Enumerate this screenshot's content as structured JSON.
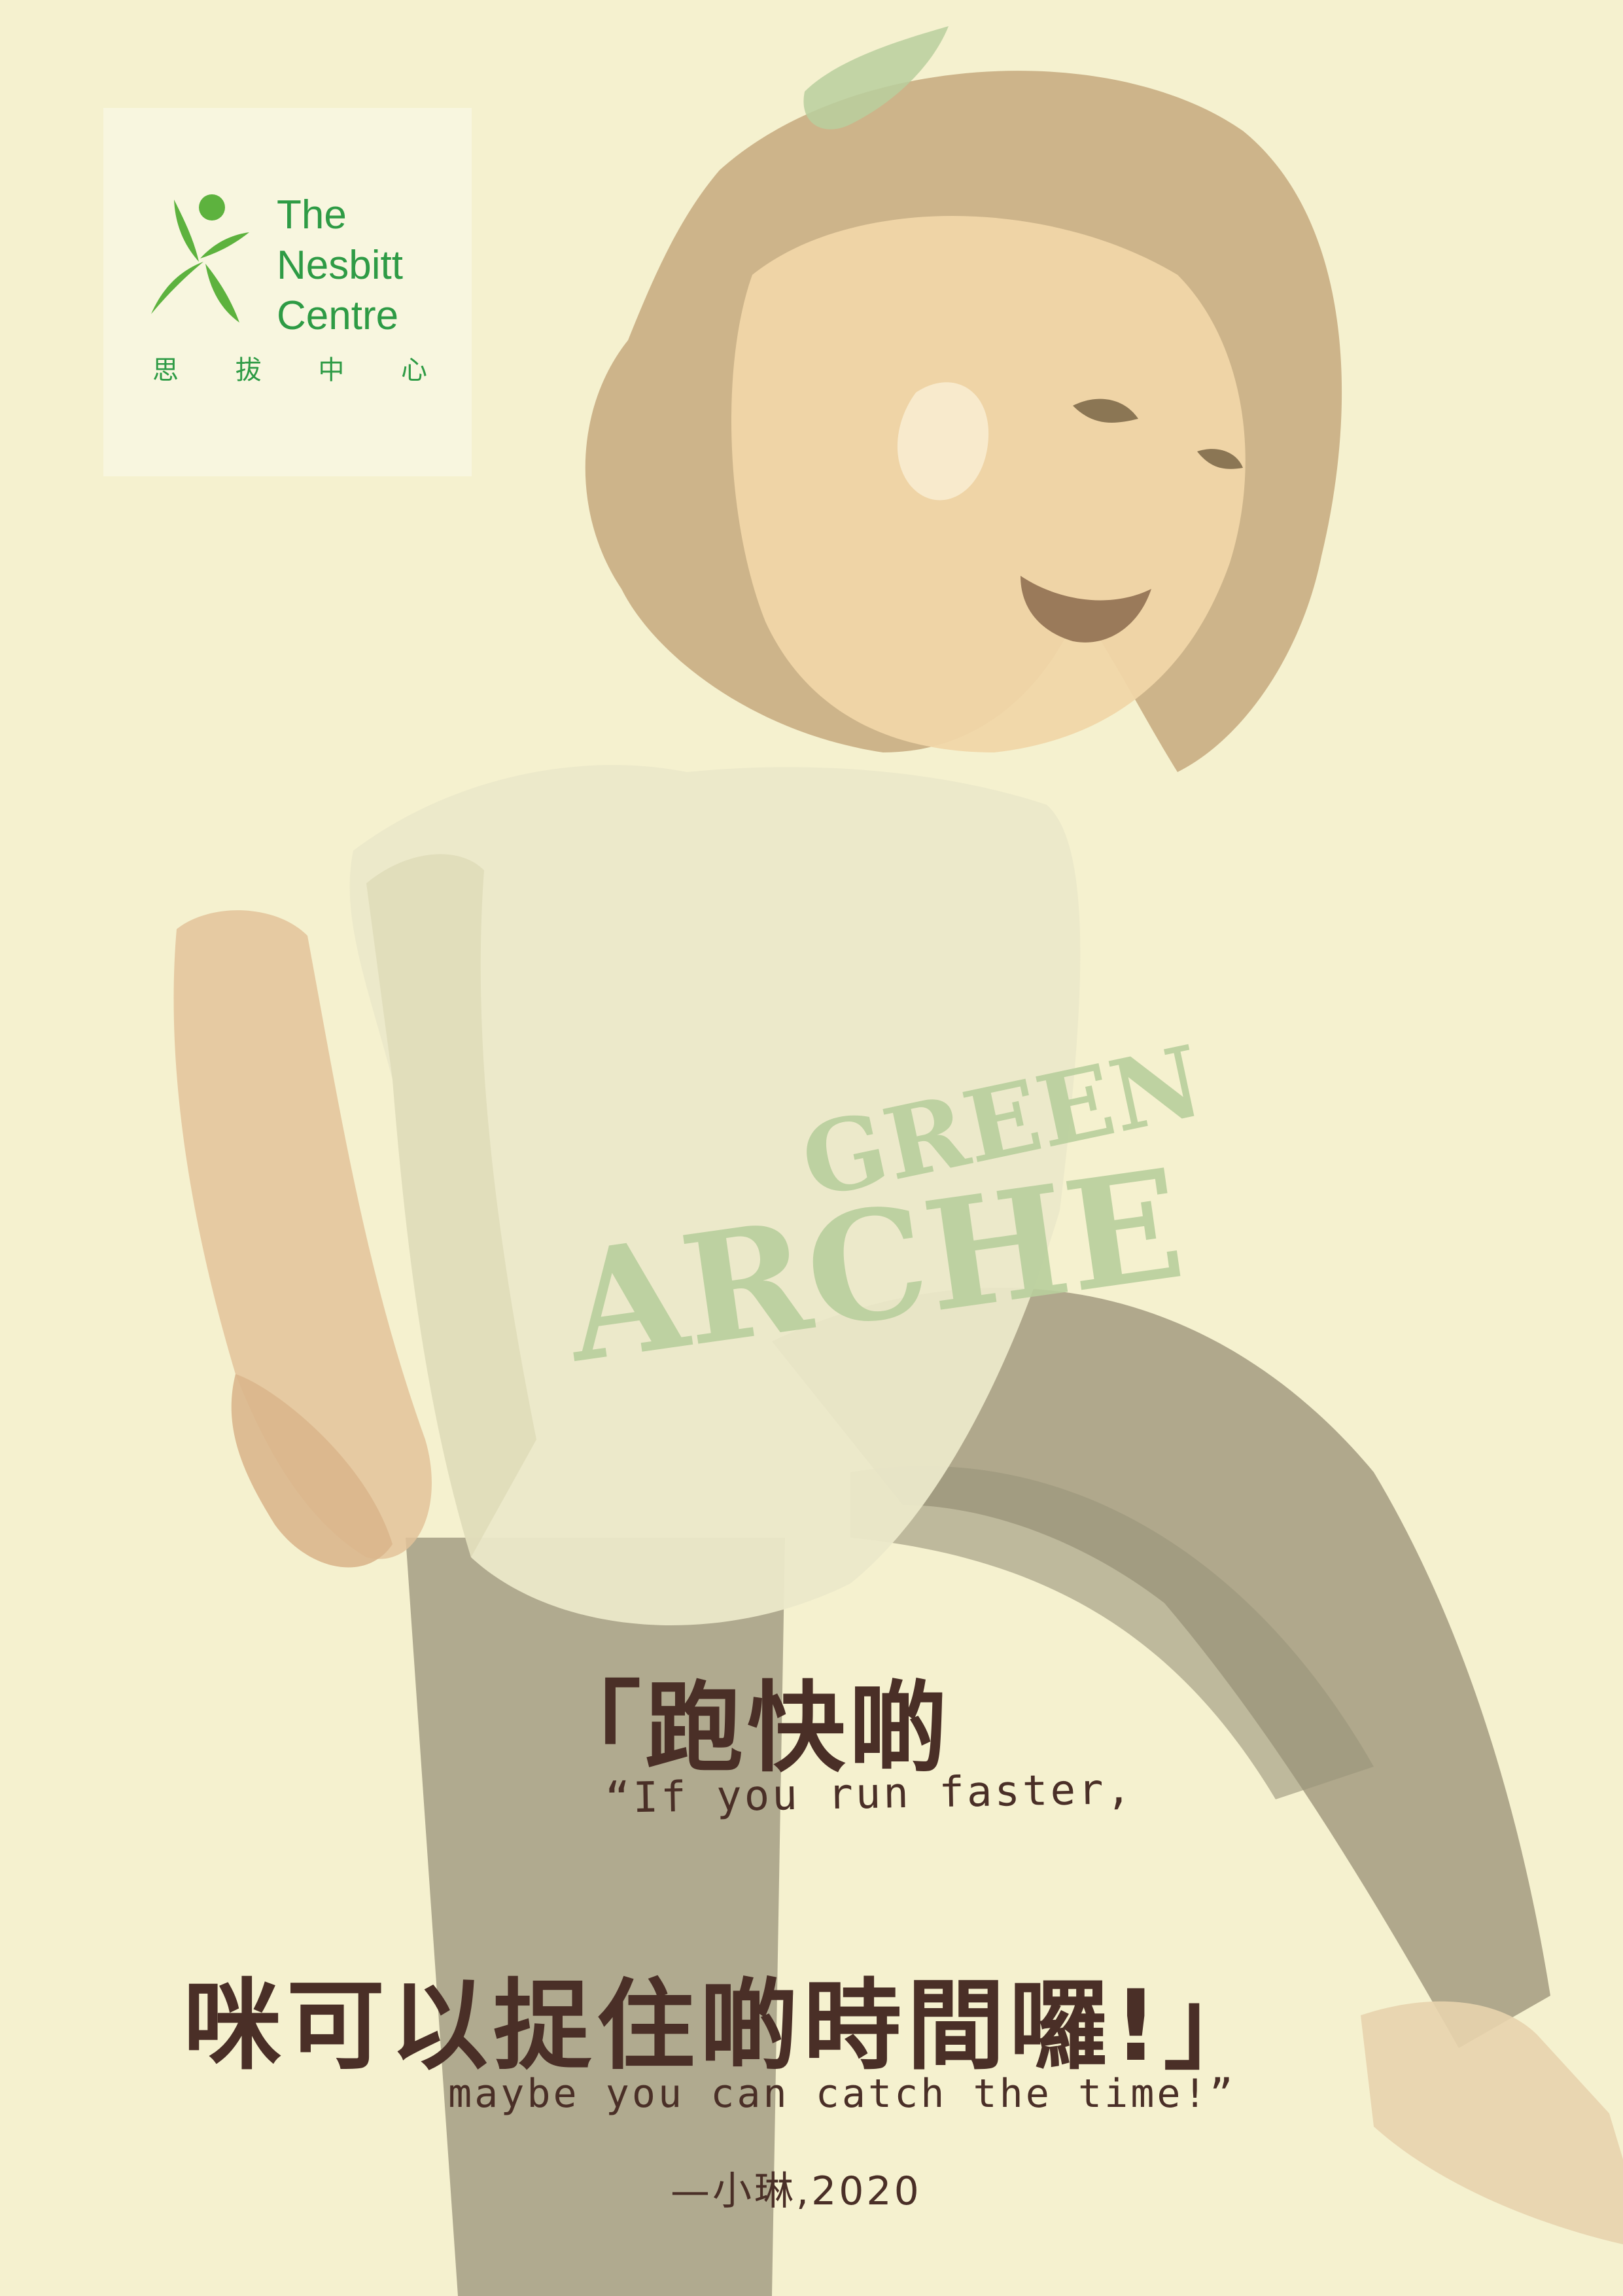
{
  "logo": {
    "name_lines": [
      "The",
      "Nesbitt",
      "Centre"
    ],
    "chinese_chars": [
      "思",
      "拔",
      "中",
      "心"
    ],
    "color": "#2e9b45",
    "leaf_color": "#5db23e"
  },
  "illustration": {
    "shirt_text_line1": "GREEN",
    "shirt_text_line2": "ARCHE",
    "background_color": "#f5f1cf",
    "shirt_print_color": "#b9cf9d"
  },
  "quote": {
    "chinese_line1": "「跑快啲",
    "english_line1": "“If you run faster,",
    "chinese_line2": "咪可以捉住啲時間囉!」",
    "english_line2": "maybe you can catch the time!”",
    "attribution": "—小琳,2020",
    "text_color": "#4a2f27"
  }
}
